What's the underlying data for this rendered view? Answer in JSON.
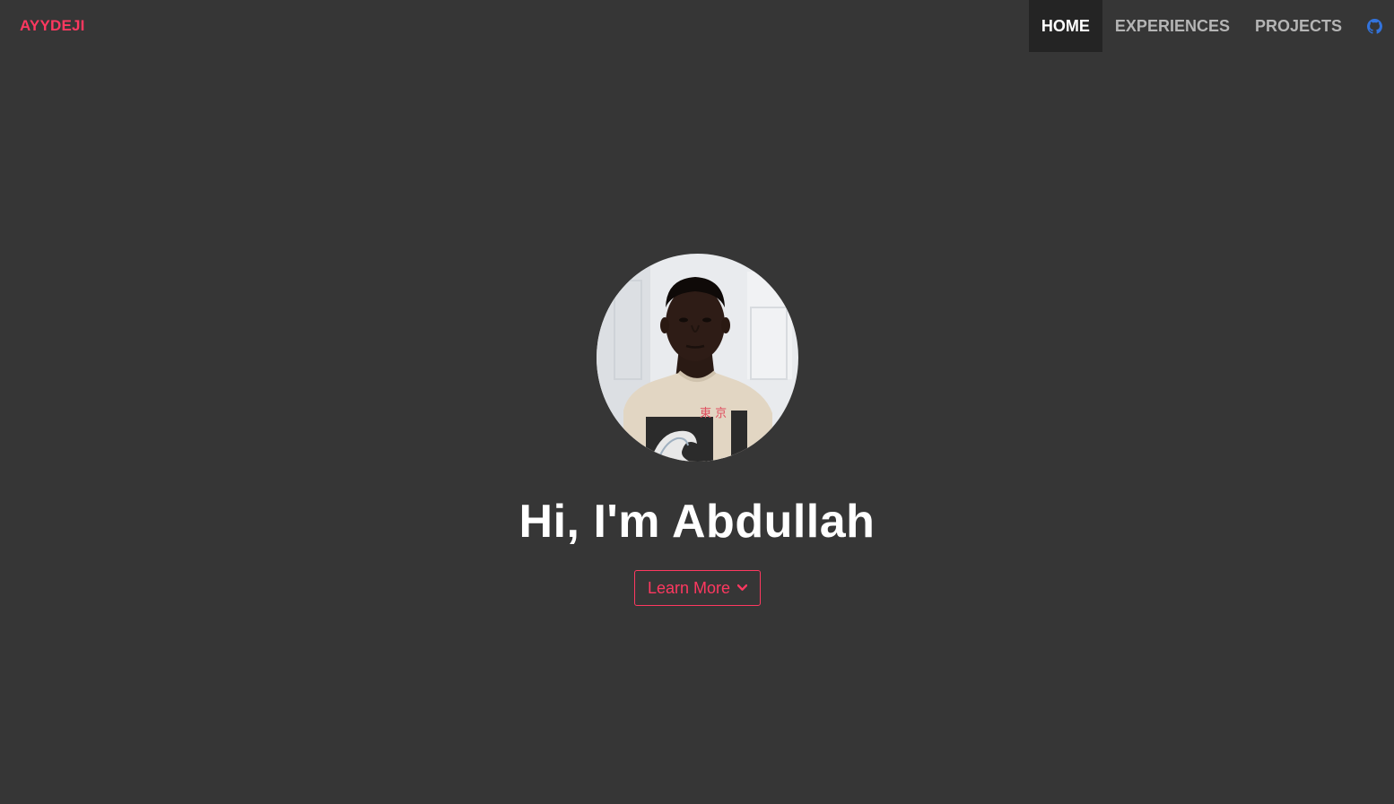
{
  "brand": {
    "label": "AYYDEJI",
    "color": "#ff3860"
  },
  "nav": {
    "items": [
      {
        "label": "HOME",
        "active": true
      },
      {
        "label": "EXPERIENCES",
        "active": false
      },
      {
        "label": "PROJECTS",
        "active": false
      }
    ],
    "github_icon": "github-icon",
    "github_color": "#3273dc"
  },
  "hero": {
    "avatar_alt": "profile-photo",
    "title": "Hi, I'm Abdullah",
    "cta_label": "Learn More",
    "cta_icon": "chevron-down-icon"
  },
  "colors": {
    "background": "#363636",
    "accent": "#ff3860",
    "active_nav_bg": "#242424"
  }
}
